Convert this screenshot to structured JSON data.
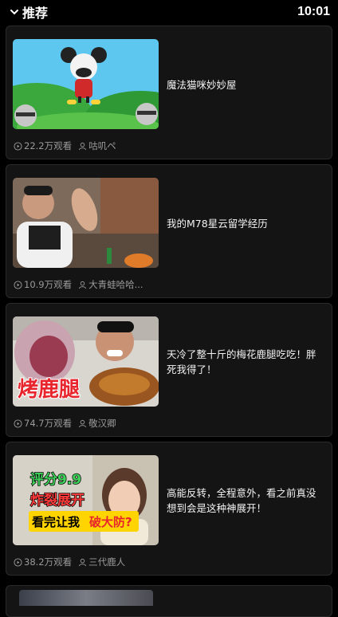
{
  "header": {
    "title": "推荐",
    "time": "10:01"
  },
  "videos": [
    {
      "title": "魔法猫咪妙妙屋",
      "views": "22.2万观看",
      "author": "咕叽ペ"
    },
    {
      "title": "我的M78星云留学经历",
      "views": "10.9万观看",
      "author": "大青蛙哈哈..."
    },
    {
      "title": "天冷了整十斤的梅花鹿腿吃吃！胖死我得了！",
      "views": "74.7万观看",
      "author": "敬汉卿",
      "thumb_caption": "烤鹿腿"
    },
    {
      "title": "高能反转，全程意外，看之前真没想到会是这种神展开！",
      "views": "38.2万观看",
      "author": "三代鹿人",
      "thumb_lines": [
        "评分9.9",
        "炸裂展开",
        "看完让我",
        "破大防?"
      ]
    }
  ],
  "colors": {
    "background": "#000000",
    "card": "#141414",
    "meta": "#9a9a9a"
  }
}
